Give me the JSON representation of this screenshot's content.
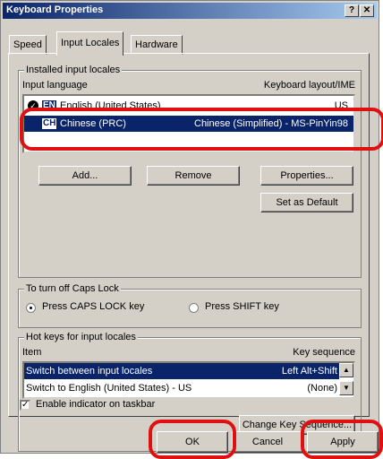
{
  "window": {
    "title": "Keyboard Properties",
    "help_glyph": "?",
    "close_glyph": "✕"
  },
  "tabs": [
    {
      "label": "Speed"
    },
    {
      "label": "Input Locales"
    },
    {
      "label": "Hardware"
    }
  ],
  "installed": {
    "group_label": "Installed input locales",
    "col_language": "Input language",
    "col_layout": "Keyboard layout/IME",
    "rows": [
      {
        "badge": "EN",
        "language": "English (United States)",
        "layout": "US"
      },
      {
        "badge": "CH",
        "language": "Chinese (PRC)",
        "layout": "Chinese (Simplified) - MS-PinYin98"
      }
    ],
    "add_label": "Add...",
    "remove_label": "Remove",
    "properties_label": "Properties...",
    "set_default_label": "Set as Default"
  },
  "caps": {
    "group_label": "To turn off Caps Lock",
    "option1": "Press CAPS LOCK key",
    "option2": "Press SHIFT key",
    "selected": "option1"
  },
  "hotkeys": {
    "group_label": "Hot keys for input locales",
    "col_item": "Item",
    "col_seq": "Key sequence",
    "rows": [
      {
        "item": "Switch between input locales",
        "seq": "Left Alt+Shift"
      },
      {
        "item": "Switch to English (United States) - US",
        "seq": "(None)"
      }
    ],
    "change_label": "Change Key Sequence..."
  },
  "indicator": {
    "label": "Enable indicator on taskbar",
    "checked": true
  },
  "footer": {
    "ok_label": "OK",
    "cancel_label": "Cancel",
    "apply_label": "Apply"
  },
  "colors": {
    "selection": "#0a246a",
    "highlight_ring": "#e01010",
    "face": "#d4d0c8"
  }
}
